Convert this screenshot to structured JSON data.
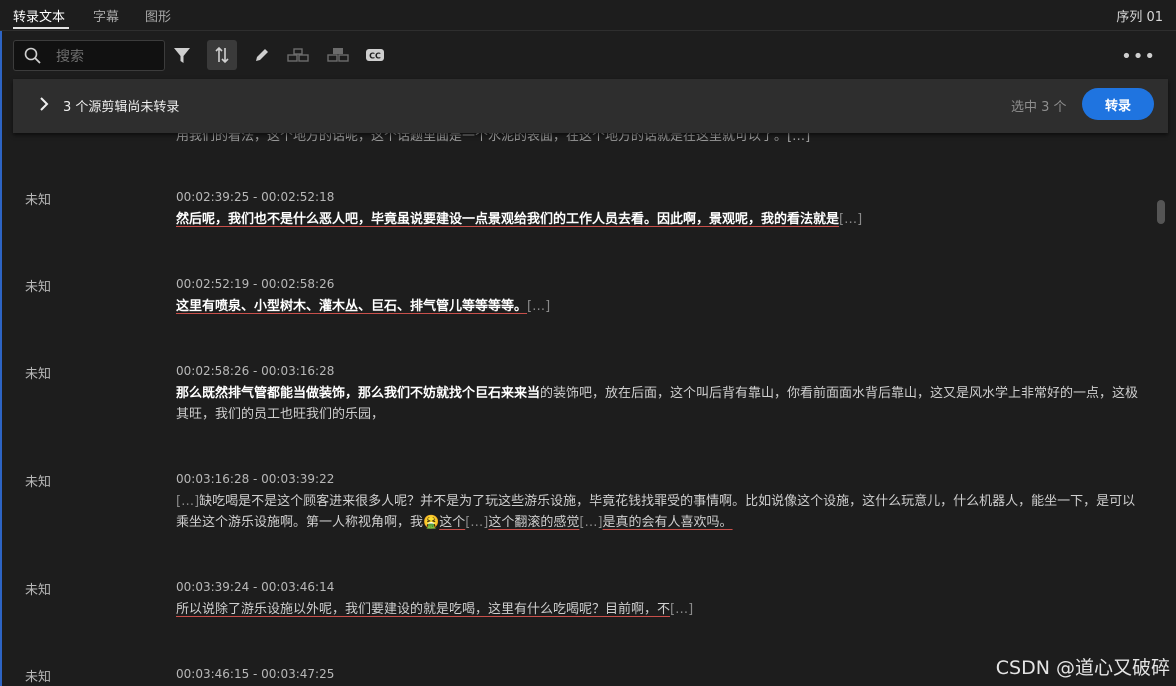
{
  "tabs": [
    {
      "label": "转录文本"
    },
    {
      "label": "字幕"
    },
    {
      "label": "图形"
    }
  ],
  "sequence_label": "序列 01",
  "search": {
    "placeholder": "搜索"
  },
  "banner": {
    "message": "3 个源剪辑尚未转录",
    "selected": "选中 3 个",
    "button": "转录"
  },
  "partial_line": "用我们的看法，这个地方的话呢，这个话题里面是一个水泥的表面，在这个地方的话就是在这里就可以了。[…]",
  "entries": [
    {
      "speaker": "未知",
      "time": "00:02:39:25 - 00:02:52:18",
      "segments": [
        {
          "t": "然后呢，我们也不是什么恶人吧，毕竟虽说要建设一点景观给我们的工作人员去看。因此啊，景观呢，我的看法就是",
          "c": "u b"
        },
        {
          "t": "[…]",
          "c": "el"
        }
      ]
    },
    {
      "speaker": "未知",
      "time": "00:02:52:19 - 00:02:58:26",
      "segments": [
        {
          "t": "这里有喷泉、小型树木、灌木丛、巨石、排气管儿等等等等。",
          "c": "u b"
        },
        {
          "t": "[…]",
          "c": "el"
        }
      ]
    },
    {
      "speaker": "未知",
      "time": "00:02:58:26 - 00:03:16:28",
      "segments": [
        {
          "t": "那么既然排气管都能当做装饰，那么我们不妨就找个巨石来来当",
          "c": "b"
        },
        {
          "t": "的装饰吧，放在后面，这个叫后背有靠山，你看前面面水背后靠山，这又是风水学上非常好的一点，这极其旺，我们的员工也旺我们的乐园，",
          "c": ""
        }
      ]
    },
    {
      "speaker": "未知",
      "time": "00:03:16:28 - 00:03:39:22",
      "segments": [
        {
          "t": "[…]",
          "c": "el"
        },
        {
          "t": "缺吃喝是不是这个顾客进来很多人呢？并不是为了玩这些游乐设施，毕竟花钱找罪受的事情啊。比如说像这个设施，这什么玩意儿，什么机器人，能坐一下，是可以乘坐这个游乐设施啊。第一人称视角啊，我",
          "c": ""
        },
        {
          "t": "🤮",
          "c": ""
        },
        {
          "t": "这个",
          "c": "u"
        },
        {
          "t": "[…]",
          "c": "el"
        },
        {
          "t": "这个翻滚的感觉",
          "c": "u"
        },
        {
          "t": "[…]",
          "c": "el"
        },
        {
          "t": "是真的会有人喜欢吗。",
          "c": "u"
        }
      ]
    },
    {
      "speaker": "未知",
      "time": "00:03:39:24 - 00:03:46:14",
      "segments": [
        {
          "t": "所以说除了游乐设施以外呢，我们要建设的就是吃喝，这里有什么吃喝呢？目前啊，不",
          "c": "u"
        },
        {
          "t": "[…]",
          "c": "el"
        }
      ]
    },
    {
      "speaker": "未知",
      "time": "00:03:46:15 - 00:03:47:25",
      "segments": []
    }
  ],
  "watermark": "CSDN @道心又破碎",
  "colors": {
    "accent": "#1f74e0",
    "underline": "#c9504b",
    "background": "#1d1d1d"
  }
}
